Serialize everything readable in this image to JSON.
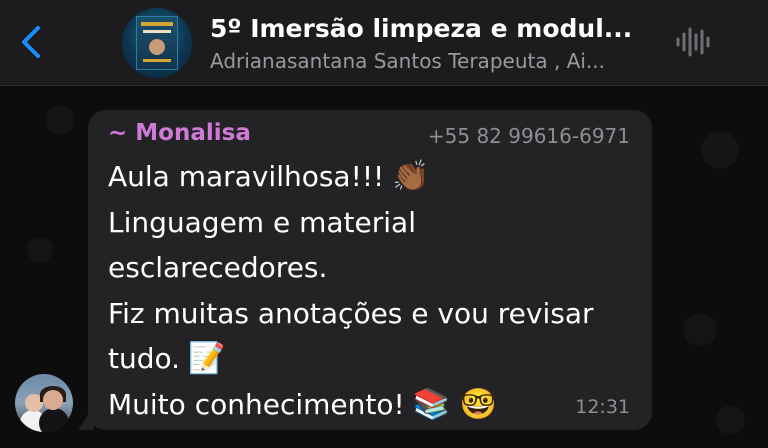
{
  "header": {
    "back_icon": "chevron-left-icon",
    "title": "5º Imersão limpeza e modul...",
    "subtitle": "Adrianasantana Santos Terapeuta , Ai...",
    "audio_icon": "waveform-icon",
    "accent": "#1a8cff"
  },
  "message": {
    "sender_name": "~ Monalisa",
    "sender_color": "#d07ad8",
    "sender_phone": "+55 82 99616-6971",
    "lines": [
      {
        "text": "Aula maravilhosa!!!",
        "emoji": "👏🏾"
      },
      {
        "text": "Linguagem e material",
        "emoji": ""
      },
      {
        "text": "esclarecedores.",
        "emoji": ""
      },
      {
        "text": "Fiz muitas anotações e vou revisar",
        "emoji": ""
      },
      {
        "text": "tudo.",
        "emoji": "📝"
      },
      {
        "text": "Muito conhecimento!",
        "emoji": "📚 🤓"
      }
    ],
    "time": "12:31"
  }
}
